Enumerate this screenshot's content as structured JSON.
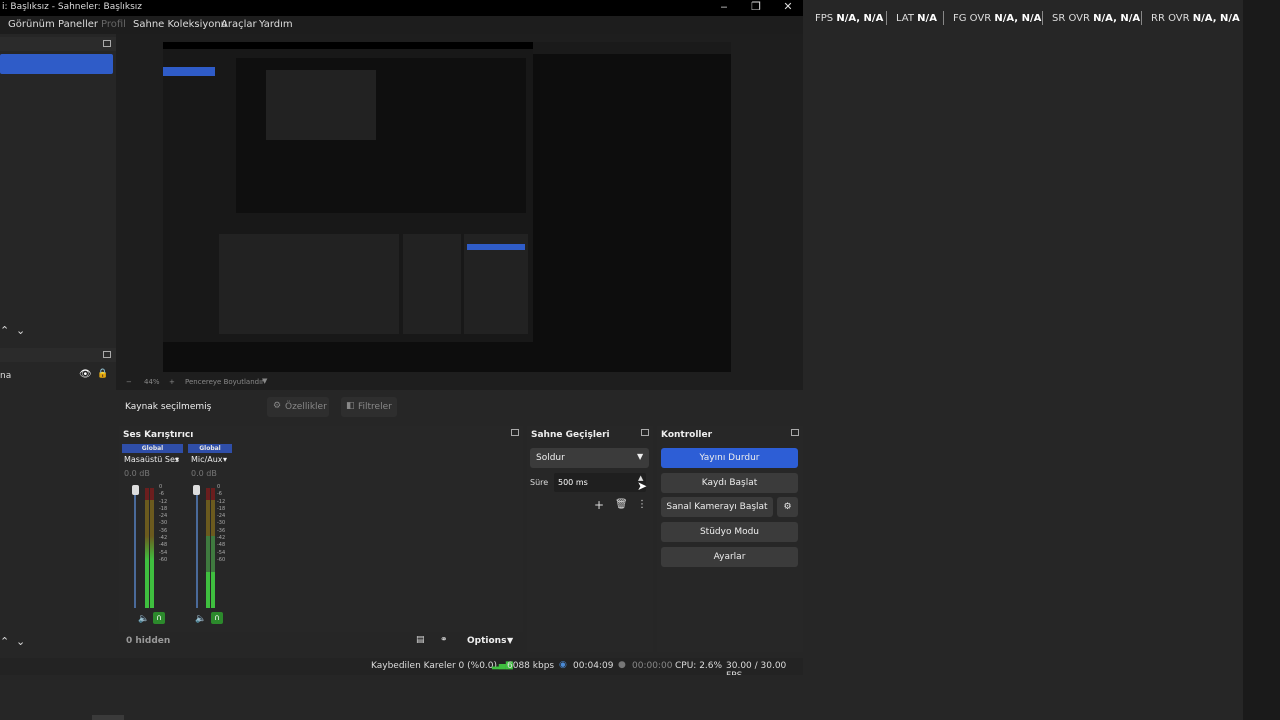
{
  "window": {
    "title": "i: Başlıksız - Sahneler: Başlıksız",
    "minimize": "‒",
    "maximize": "❐",
    "close": "✕"
  },
  "menu": [
    "Görünüm",
    "Paneller",
    "Profil",
    "Sahne Koleksiyonu",
    "Araçlar",
    "Yardım"
  ],
  "stats": {
    "fps_label": "FPS",
    "fps_value": "N/A, N/A",
    "lat_label": "LAT",
    "lat_value": "N/A",
    "fg_label": "FG OVR",
    "fg_value": "N/A, N/A",
    "sr_label": "SR OVR",
    "sr_value": "N/A, N/A",
    "rr_label": "RR OVR",
    "rr_value": "N/A, N/A"
  },
  "sources": {
    "item_label": "na"
  },
  "preview": {
    "zoom_value": "44%",
    "fit_label": "Pencereye Boyutlandır"
  },
  "context": {
    "no_source": "Kaynak seçilmemiş",
    "properties": "Özellikler",
    "filters": "Filtreler"
  },
  "mixer": {
    "title": "Ses Karıştırıcı",
    "channels": [
      {
        "global": "Global",
        "name": "Masaüstü Ses",
        "db": "0.0 dB"
      },
      {
        "global": "Global",
        "name": "Mic/Aux",
        "db": "0.0 dB"
      }
    ],
    "scale": [
      "0",
      "-6",
      "-12",
      "-18",
      "-24",
      "-30",
      "-36",
      "-42",
      "-48",
      "-54",
      "-60"
    ],
    "hidden": "0 hidden",
    "options": "Options"
  },
  "transitions": {
    "title": "Sahne Geçişleri",
    "selected": "Soldur",
    "duration_label": "Süre",
    "duration_value": "500 ms"
  },
  "controls": {
    "title": "Kontroller",
    "stop_stream": "Yayını Durdur",
    "start_record": "Kaydı Başlat",
    "virtual_cam": "Sanal Kamerayı Başlat",
    "studio_mode": "Stüdyo Modu",
    "settings": "Ayarlar"
  },
  "status": {
    "dropped": "Kaybedilen Kareler 0 (%0.0)",
    "bitrate": "6088 kbps",
    "stream_time": "00:04:09",
    "rec_time": "00:00:00",
    "cpu": "CPU: 2.6%",
    "fps": "30.00 / 30.00 FPS"
  },
  "colors": {
    "accent": "#2d5ed6",
    "meter_green": "#3fbf3f",
    "background": "#262626"
  }
}
